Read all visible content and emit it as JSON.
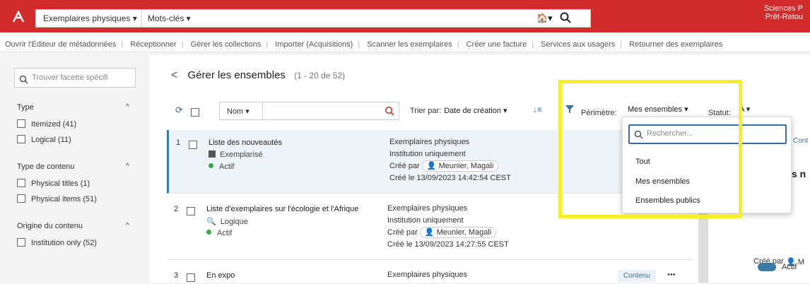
{
  "topbar": {
    "scope_label": "Exemplaires physiques ▾",
    "keywords_label": "Mots-clés ▾",
    "home_label": "🏠▾",
    "institution_line1": "Sciences P",
    "institution_line2": "Prêt-Retou"
  },
  "actionbar": {
    "items": [
      "Ouvrir l'Éditeur de métadonnées",
      "Réceptionner",
      "Gérer les collections",
      "Importer (Acquisitions)",
      "Scanner les exemplaires",
      "Créer une facture",
      "Services aux usagers",
      "Retourner des exemplaires"
    ]
  },
  "facets": {
    "search_placeholder": "Trouver facette spécifi",
    "groups": [
      {
        "title": "Type",
        "items": [
          "Itemized (41)",
          "Logical (11)"
        ]
      },
      {
        "title": "Type de contenu",
        "items": [
          "Physical titles (1)",
          "Physical items (51)"
        ]
      },
      {
        "title": "Origine du contenu",
        "items": [
          "Institution only (52)"
        ]
      }
    ]
  },
  "page": {
    "back": "<",
    "title": "Gérer les ensembles",
    "count": "(1 - 20 de 52)"
  },
  "toolbar": {
    "name_field": "Nom ▾",
    "sort_label": "Trier par:",
    "sort_value": "Date de création ▾",
    "scope_label": "Périmètre:",
    "scope_value": "Mes ensembles ▾",
    "status_label": "Statut:",
    "status_value": "A ▾"
  },
  "rows": [
    {
      "num": "1",
      "title": "Liste des nouveautés",
      "type": "Exemplarisé",
      "status": "Actif",
      "meta1": "Exemplaires physiques",
      "meta2": "Institution uniquement",
      "created_by_label": "Créé par",
      "creator": "Meunier, Magali",
      "created_on": "Créé le 13/09/2023 14:42:54 CEST"
    },
    {
      "num": "2",
      "title": "Liste d'exemplaires sur l'écologie et l'Afrique",
      "type": "Logique",
      "status": "Actif",
      "meta1": "Exemplaires physiques",
      "meta2": "Institution uniquement",
      "created_by_label": "Créé par",
      "creator": "Meunier, Magali",
      "created_on": "Créé le 13/09/2023 14:27:55 CEST"
    },
    {
      "num": "3",
      "title": "En expo",
      "type": "",
      "status": "",
      "meta1": "Exemplaires physiques",
      "meta2": "",
      "contenu": "Contenu",
      "more": "•••"
    }
  ],
  "dropdown": {
    "placeholder": "Rechercher...",
    "items": [
      "Tout",
      "Mes ensembles",
      "Ensembles publics"
    ]
  },
  "rpanel": {
    "cont": "Cont",
    "s_n": "s n",
    "created_by": "Créé par",
    "m": "M",
    "actif": "Actif"
  },
  "colors": {
    "brand_red": "#d12b2b",
    "highlight_yellow": "#f7ef26",
    "active_green": "#3aa54a",
    "link_blue": "#3a6ea5"
  }
}
